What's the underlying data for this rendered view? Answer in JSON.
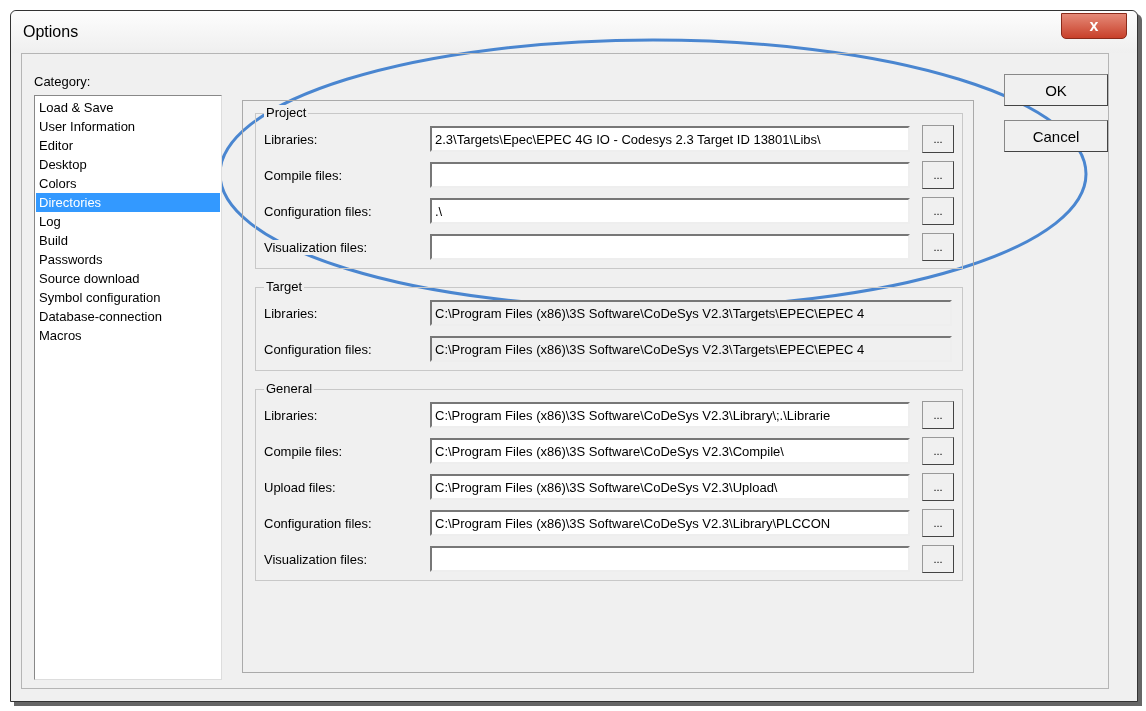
{
  "window": {
    "title": "Options",
    "close": "x"
  },
  "category": {
    "label": "Category:",
    "items": [
      {
        "label": "Load & Save",
        "selected": false
      },
      {
        "label": "User Information",
        "selected": false
      },
      {
        "label": "Editor",
        "selected": false
      },
      {
        "label": "Desktop",
        "selected": false
      },
      {
        "label": "Colors",
        "selected": false
      },
      {
        "label": "Directories",
        "selected": true
      },
      {
        "label": "Log",
        "selected": false
      },
      {
        "label": "Build",
        "selected": false
      },
      {
        "label": "Passwords",
        "selected": false
      },
      {
        "label": "Source download",
        "selected": false
      },
      {
        "label": "Symbol configuration",
        "selected": false
      },
      {
        "label": "Database-connection",
        "selected": false
      },
      {
        "label": "Macros",
        "selected": false
      }
    ]
  },
  "groups": [
    {
      "title": "Project",
      "fields": [
        {
          "label": "Libraries:",
          "value": "2.3\\Targets\\Epec\\EPEC 4G IO - Codesys 2.3 Target ID 13801\\Libs\\",
          "readonly": false,
          "browse": "..."
        },
        {
          "label": "Compile files:",
          "readonly": false,
          "browse": "..."
        },
        {
          "label": "Configuration files:",
          "value": ".\\",
          "readonly": false,
          "browse": "..."
        },
        {
          "label": "Visualization files:",
          "readonly": false,
          "browse": "..."
        }
      ]
    },
    {
      "title": "Target",
      "fields": [
        {
          "label": "Libraries:",
          "value": "C:\\Program Files (x86)\\3S Software\\CoDeSys V2.3\\Targets\\EPEC\\EPEC 4",
          "readonly": true
        },
        {
          "label": "Configuration files:",
          "value": "C:\\Program Files (x86)\\3S Software\\CoDeSys V2.3\\Targets\\EPEC\\EPEC 4",
          "readonly": true
        }
      ]
    },
    {
      "title": "General",
      "fields": [
        {
          "label": "Libraries:",
          "value": "C:\\Program Files (x86)\\3S Software\\CoDeSys V2.3\\Library\\;.\\Librarie",
          "readonly": false,
          "browse": "..."
        },
        {
          "label": "Compile files:",
          "value": "C:\\Program Files (x86)\\3S Software\\CoDeSys V2.3\\Compile\\",
          "readonly": false,
          "browse": "..."
        },
        {
          "label": "Upload files:",
          "value": "C:\\Program Files (x86)\\3S Software\\CoDeSys V2.3\\Upload\\",
          "readonly": false,
          "browse": "..."
        },
        {
          "label": "Configuration files:",
          "value": "C:\\Program Files (x86)\\3S Software\\CoDeSys V2.3\\Library\\PLCCON",
          "readonly": false,
          "browse": "..."
        },
        {
          "label": "Visualization files:",
          "readonly": false,
          "browse": "..."
        }
      ]
    }
  ],
  "buttons": [
    "OK",
    "Cancel"
  ]
}
